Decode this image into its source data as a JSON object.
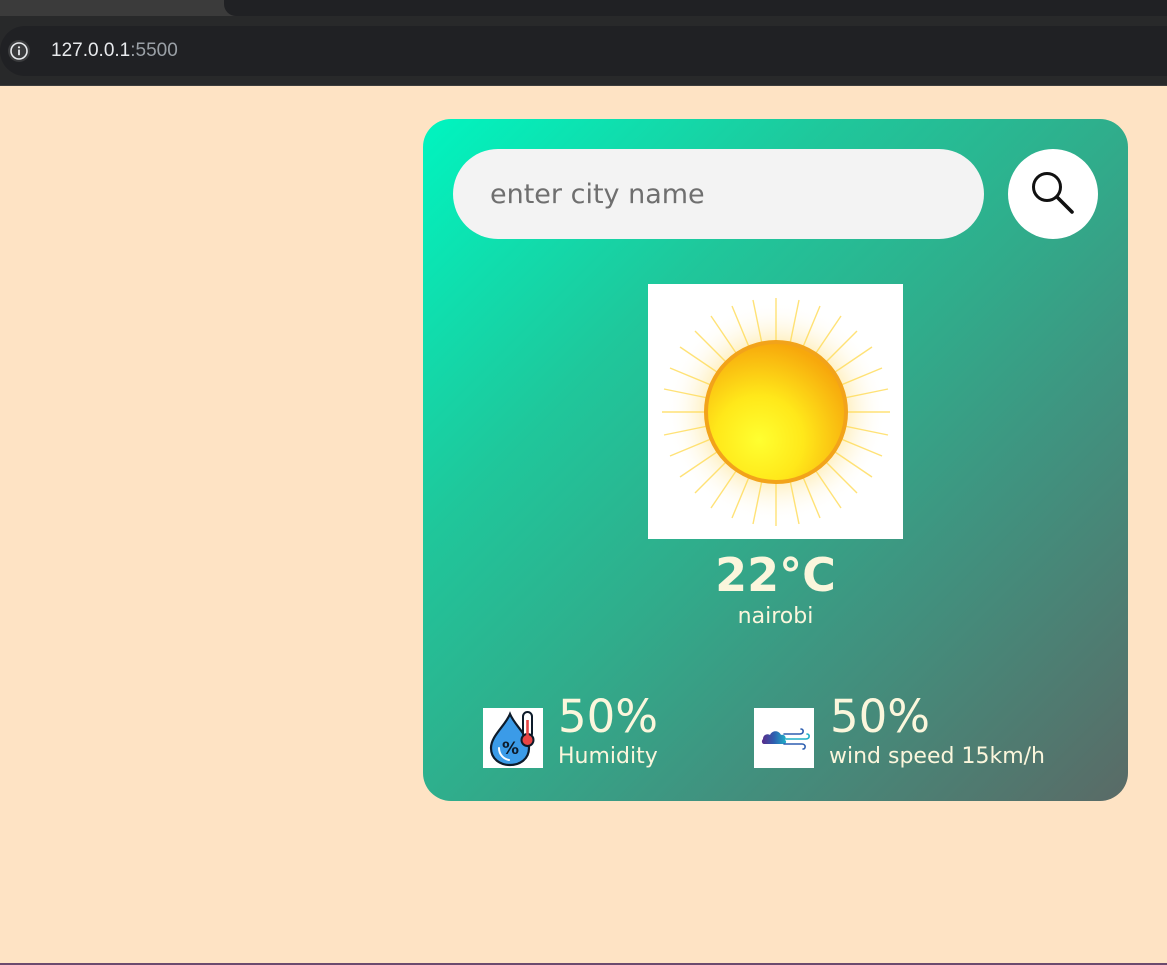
{
  "browser": {
    "url_host": "127.0.0.1",
    "url_port": ":5500"
  },
  "search": {
    "placeholder": "enter city name",
    "value": ""
  },
  "weather": {
    "icon": "sun-icon",
    "temperature": "22°C",
    "city": "nairobi"
  },
  "details": {
    "humidity": {
      "value": "50%",
      "label": "Humidity",
      "icon": "humidity-icon"
    },
    "wind": {
      "value": "50%",
      "label": "wind speed 15km/h",
      "icon": "wind-icon"
    }
  },
  "colors": {
    "page_background": "#fee3c4",
    "card_gradient_start": "#00f5c0",
    "card_gradient_end": "#5a6a66",
    "text_color": "#fbf6dc"
  }
}
